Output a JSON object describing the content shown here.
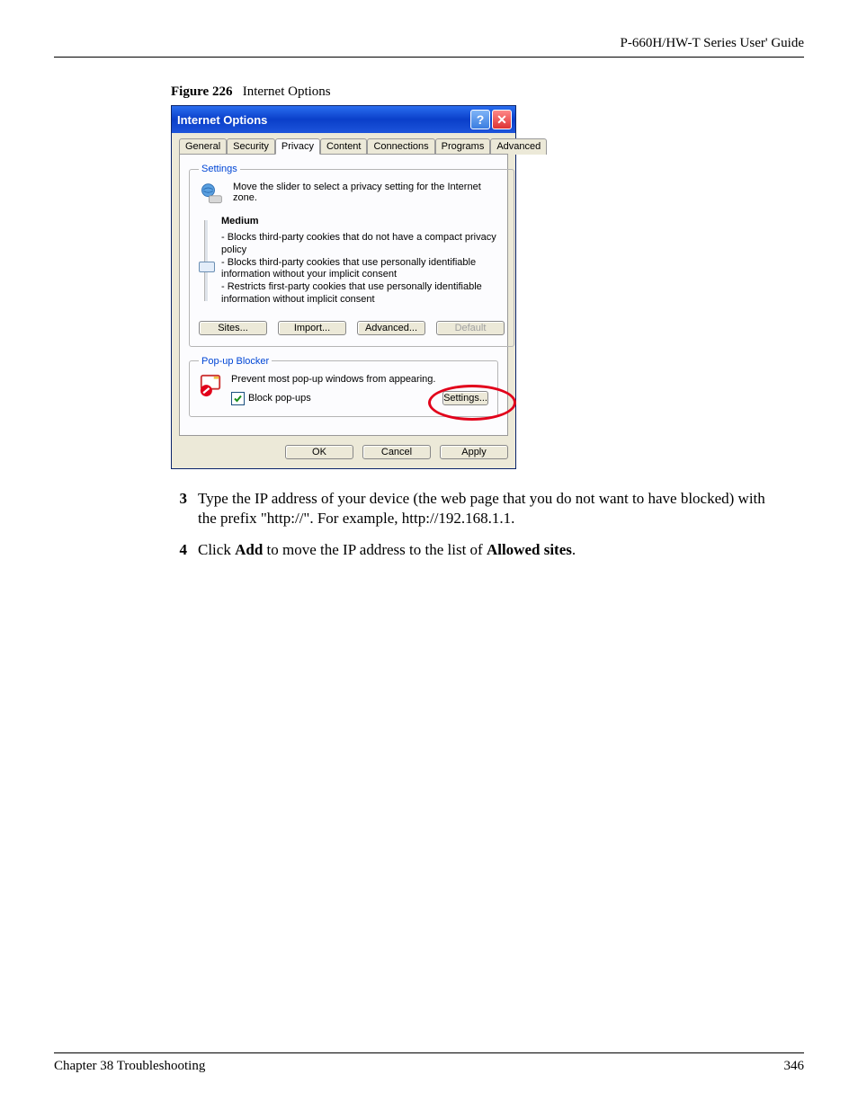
{
  "page": {
    "header_right": "P-660H/HW-T Series User' Guide",
    "footer_left": "Chapter 38 Troubleshooting",
    "footer_right": "346"
  },
  "figure": {
    "label": "Figure 226",
    "caption": "Internet Options"
  },
  "dialog": {
    "title": "Internet Options",
    "tabs": {
      "general": "General",
      "security": "Security",
      "privacy": "Privacy",
      "content": "Content",
      "connections": "Connections",
      "programs": "Programs",
      "advanced": "Advanced"
    },
    "settings_group": {
      "legend": "Settings",
      "instruction": "Move the slider to select a privacy setting for the Internet zone.",
      "level_name": "Medium",
      "desc_line1": "- Blocks third-party cookies that do not have a compact privacy policy",
      "desc_line2": "- Blocks third-party cookies that use personally identifiable information without your implicit consent",
      "desc_line3": "- Restricts first-party cookies that use personally identifiable information without implicit consent",
      "btn_sites": "Sites...",
      "btn_import": "Import...",
      "btn_advanced": "Advanced...",
      "btn_default": "Default"
    },
    "popup_group": {
      "legend": "Pop-up Blocker",
      "desc": "Prevent most pop-up windows from appearing.",
      "checkbox": "Block pop-ups",
      "btn_settings": "Settings..."
    },
    "buttons": {
      "ok": "OK",
      "cancel": "Cancel",
      "apply": "Apply"
    }
  },
  "steps": {
    "s3": {
      "num": "3",
      "text_a": "Type the IP address of your device (the web page that you do not want to have blocked) with the prefix \"http://\". For example, http://192.168.1.1."
    },
    "s4": {
      "num": "4",
      "text_a": "Click ",
      "bold1": "Add",
      "text_b": " to move the IP address to the list of ",
      "bold2": "Allowed sites",
      "text_c": "."
    }
  }
}
